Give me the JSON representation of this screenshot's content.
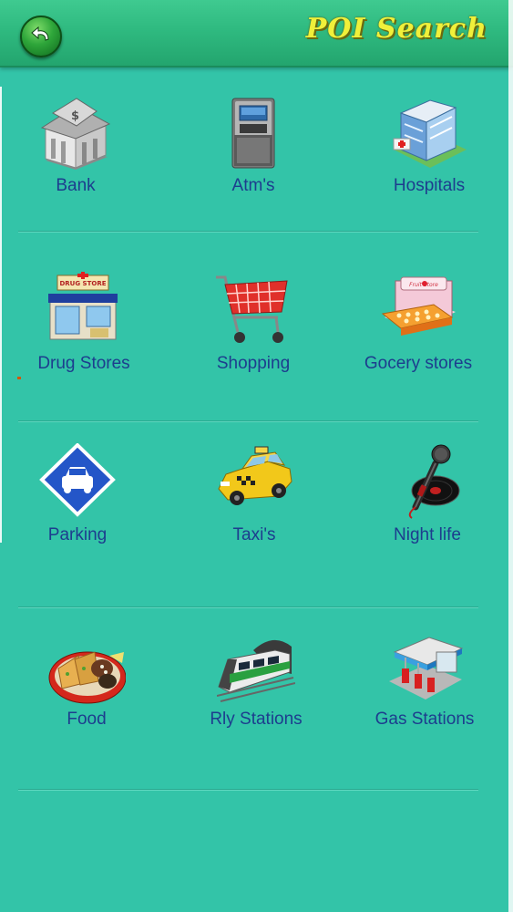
{
  "header": {
    "title": "POI Search"
  },
  "categories": [
    {
      "label": "Bank",
      "icon": "bank-icon"
    },
    {
      "label": "Atm's",
      "icon": "atm-icon"
    },
    {
      "label": "Hospitals",
      "icon": "hospital-icon"
    },
    {
      "label": "Drug Stores",
      "icon": "drug-store-icon"
    },
    {
      "label": "Shopping",
      "icon": "shopping-cart-icon"
    },
    {
      "label": "Gocery stores",
      "icon": "grocery-store-icon"
    },
    {
      "label": "Parking",
      "icon": "parking-icon"
    },
    {
      "label": "Taxi's",
      "icon": "taxi-icon"
    },
    {
      "label": "Night life",
      "icon": "microphone-icon"
    },
    {
      "label": "Food",
      "icon": "food-icon"
    },
    {
      "label": "Rly Stations",
      "icon": "train-icon"
    },
    {
      "label": "Gas Stations",
      "icon": "gas-station-icon"
    }
  ],
  "icon_art": {
    "bank-icon": {
      "drug_sign": ""
    },
    "drug-store-icon": {
      "sign": "DRUG STORE"
    },
    "grocery-store-icon": {
      "sign": "Fruit Store"
    }
  },
  "colors": {
    "background": "#33c4a8",
    "header": "#2fba80",
    "title": "#f0f03a",
    "label": "#1d3d8e"
  }
}
